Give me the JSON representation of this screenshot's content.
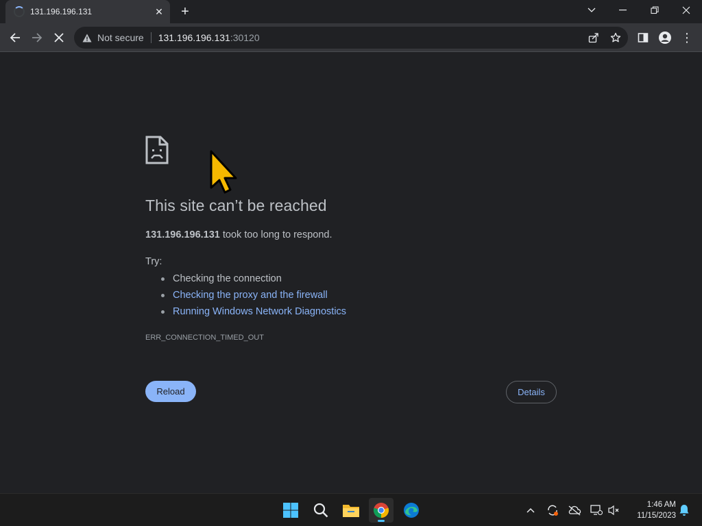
{
  "tab": {
    "title": "131.196.196.131",
    "close_glyph": "✕",
    "new_tab_glyph": "+"
  },
  "window_controls": {
    "dropdown_glyph": "⌄",
    "minimize_glyph": "—",
    "restore_glyph": "❐",
    "close_glyph": "✕"
  },
  "toolbar": {
    "back_glyph": "←",
    "forward_glyph": "→",
    "stop_glyph": "✕",
    "security_label": "Not secure",
    "url_host": "131.196.196.131",
    "url_port": ":30120",
    "menu_glyph": "⋮"
  },
  "error_page": {
    "title": "This site can’t be reached",
    "host": "131.196.196.131",
    "description": " took too long to respond.",
    "try_label": "Try:",
    "suggestions": [
      "Checking the connection",
      "Checking the proxy and the firewall",
      "Running Windows Network Diagnostics"
    ],
    "error_code": "ERR_CONNECTION_TIMED_OUT",
    "reload_label": "Reload",
    "details_label": "Details"
  },
  "taskbar": {
    "apps": [
      "start",
      "search",
      "file-explorer",
      "chrome",
      "edge"
    ],
    "tray_chevron_glyph": "⌃",
    "time": "1:46 AM",
    "date": "11/15/2023"
  },
  "colors": {
    "page_bg": "#202124",
    "toolbar_bg": "#35363a",
    "link": "#8ab4f8",
    "text": "#bdc1c6",
    "cursor": "#f5b800"
  }
}
